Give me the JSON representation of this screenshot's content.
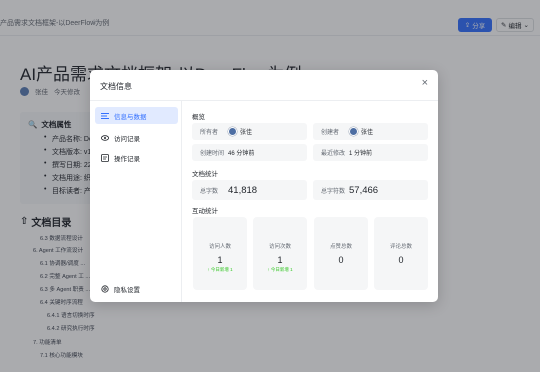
{
  "topbar": {
    "breadcrumb": "产品需求文档框架-以DeerFlow为例",
    "breadcrumb_icon": "☆",
    "share_label": "分享",
    "edit_label": "编辑"
  },
  "doc": {
    "title": "AI产品需求文档框架-以DeerFlow为例",
    "author": "张佳",
    "meta_extra": "今天修改",
    "attributes_heading": "文档属性",
    "attributes": [
      "产品名称: De",
      "文档版本: v1",
      "撰写日期: 22",
      "文档用途: 织",
      "目标读者: 产"
    ],
    "toc_heading": "文档目录",
    "toc": [
      "6.3 数据流程设计",
      "6. Agent 工作流设计",
      "6.1 协调器/调度 ...",
      "6.2 完整 Agent 工 ...",
      "6.3 多 Agent 职责 ...",
      "6.4 关键时序流程",
      "6.4.1 语言切换时序",
      "6.4.2 研究执行时序",
      "7. 功能清单",
      "7.1 核心功能模块"
    ]
  },
  "modal": {
    "title": "文档信息",
    "close": "×",
    "nav": [
      {
        "label": "信息与数据",
        "icon": "list-icon"
      },
      {
        "label": "访问记录",
        "icon": "eye-icon"
      },
      {
        "label": "操作记录",
        "icon": "history-icon"
      }
    ],
    "nav_bottom": {
      "label": "隐私设置",
      "icon": "gear-icon"
    },
    "overview_title": "概览",
    "owner_label": "所有者",
    "owner": "张佳",
    "creator_label": "创建者",
    "creator": "张佳",
    "created_label": "创建时间",
    "created": "46 分钟前",
    "modified_label": "最近修改",
    "modified": "1 分钟前",
    "doc_stats_title": "文档统计",
    "words_label": "总字数",
    "words": "41,818",
    "chars_label": "总字符数",
    "chars": "57,466",
    "interact_title": "互动统计",
    "stats": [
      {
        "label": "访问人数",
        "value": "1",
        "delta": "↑ 今日新增 1"
      },
      {
        "label": "访问次数",
        "value": "1",
        "delta": "↑ 今日新增 1"
      },
      {
        "label": "点赞总数",
        "value": "0",
        "delta": ""
      },
      {
        "label": "评论总数",
        "value": "0",
        "delta": ""
      }
    ]
  },
  "colors": {
    "accent": "#3370ff",
    "nav_active_bg": "#e1eaff",
    "positive": "#34c724"
  }
}
